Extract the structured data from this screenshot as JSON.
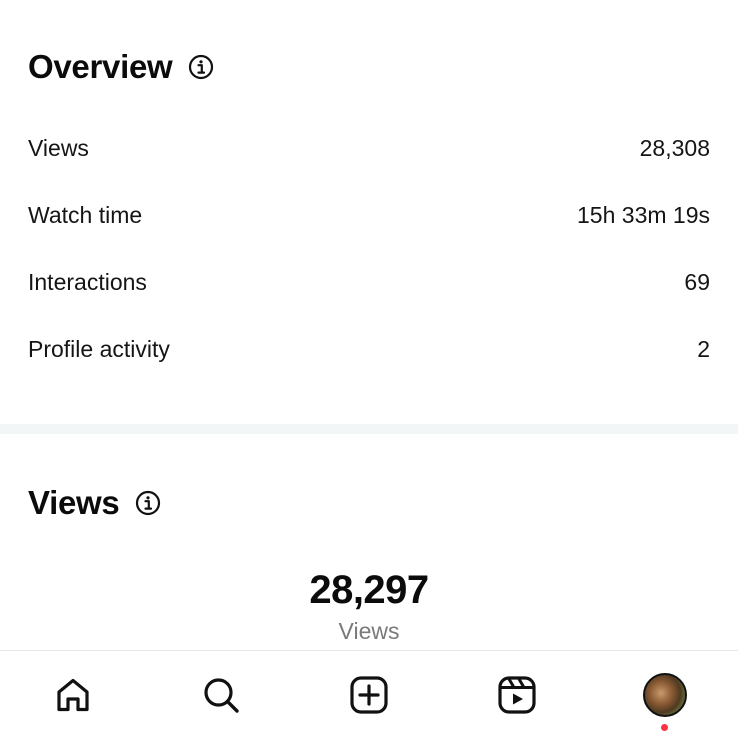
{
  "overview": {
    "title": "Overview",
    "metrics": [
      {
        "label": "Views",
        "value": "28,308"
      },
      {
        "label": "Watch time",
        "value": "15h 33m 19s"
      },
      {
        "label": "Interactions",
        "value": "69"
      },
      {
        "label": "Profile activity",
        "value": "2"
      }
    ]
  },
  "views_section": {
    "title": "Views",
    "total": "28,297",
    "caption": "Views"
  },
  "nav": {
    "items": [
      "home-icon",
      "search-icon",
      "create-icon",
      "reels-icon",
      "profile-avatar"
    ],
    "notification_color": "#ff3040"
  }
}
